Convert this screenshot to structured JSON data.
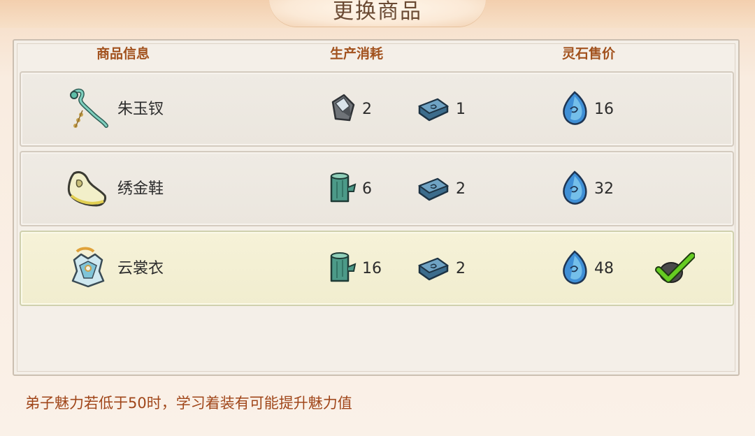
{
  "header": {
    "title": "更换商品"
  },
  "columns": {
    "info": "商品信息",
    "cost": "生产消耗",
    "price": "灵石售价"
  },
  "items": [
    {
      "name": "朱玉钗",
      "icon": "jade-hairpin-icon",
      "material_icon": "ore-icon",
      "material_qty": "2",
      "ingot_qty": "1",
      "price": "16",
      "selected": false
    },
    {
      "name": "绣金鞋",
      "icon": "embroidered-shoe-icon",
      "material_icon": "wood-log-icon",
      "material_qty": "6",
      "ingot_qty": "2",
      "price": "32",
      "selected": false
    },
    {
      "name": "云裳衣",
      "icon": "cloud-robe-icon",
      "material_icon": "wood-log-icon",
      "material_qty": "16",
      "ingot_qty": "2",
      "price": "48",
      "selected": true
    }
  ],
  "footer": {
    "hint": "弟子魅力若低于50时，学习着装有可能提升魅力值"
  },
  "colors": {
    "header_text": "#a2521e",
    "hint_text": "#a0461a",
    "selected_row": "#f4f0d4",
    "check": "#5cc21e"
  }
}
